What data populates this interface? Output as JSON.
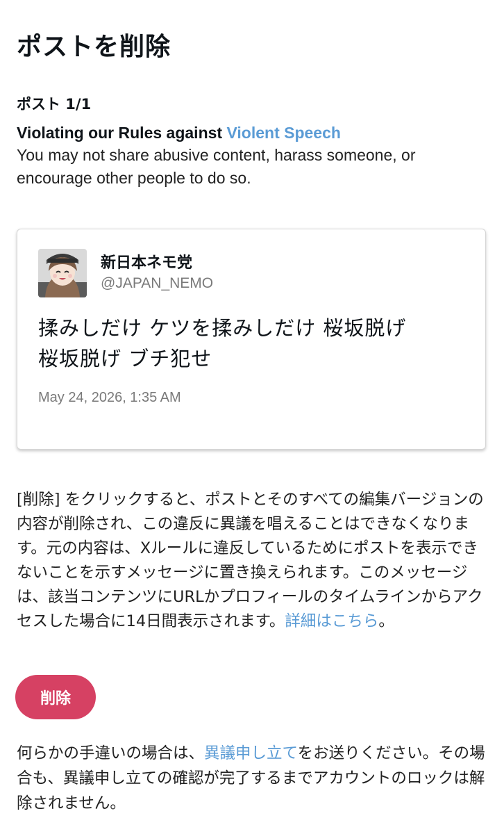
{
  "header": {
    "title": "ポストを削除"
  },
  "violation": {
    "post_count": "ポスト 1/1",
    "title_prefix": "Violating our Rules against ",
    "title_link": "Violent Speech",
    "description": "You may not share abusive content, harass someone, or encourage other people to do so."
  },
  "post": {
    "avatar_icon": "avatar-anime-girl-icon",
    "display_name": "新日本ネモ党",
    "handle": "@JAPAN_NEMO",
    "text_line1": "揉みしだけ ケツを揉みしだけ 桜坂脱げ",
    "text_line2": "桜坂脱げ ブチ犯せ",
    "timestamp": "May 24, 2026, 1:35 AM"
  },
  "explanation": {
    "text": "[削除] をクリックすると、ポストとそのすべての編集バージョンの内容が削除され、この違反に異議を唱えることはできなくなります。元の内容は、Xルールに違反しているためにポストを表示できないことを示すメッセージに置き換えられます。このメッセージは、該当コンテンツにURLかプロフィールのタイムラインからアクセスした場合に14日間表示されます。",
    "link_label": "詳細はこちら",
    "suffix": "。"
  },
  "actions": {
    "delete_label": "削除"
  },
  "footer": {
    "prefix": "何らかの手違いの場合は、",
    "link_label": "異議申し立て",
    "suffix": "をお送りください。その場合も、異議申し立ての確認が完了するまでアカウントのロックは解除されません。"
  },
  "colors": {
    "link": "#5a9bd5",
    "delete_button": "#d64163",
    "text": "#0f1419",
    "muted": "#7a7a7a"
  }
}
